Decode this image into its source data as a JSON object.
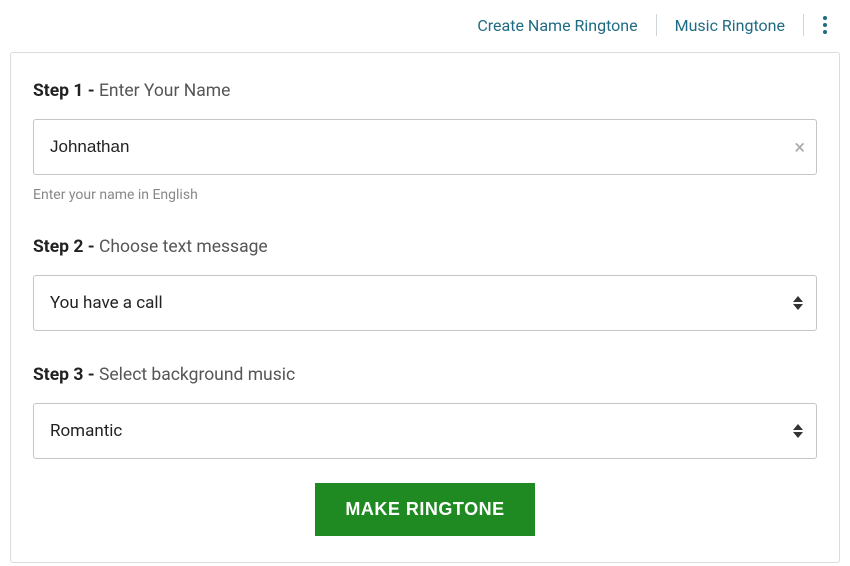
{
  "nav": {
    "link1": "Create Name Ringtone",
    "link2": "Music Ringtone"
  },
  "step1": {
    "prefix": "Step 1 - ",
    "label": "Enter Your Name",
    "value": "Johnathan",
    "hint": "Enter your name in English"
  },
  "step2": {
    "prefix": "Step 2 - ",
    "label": "Choose text message",
    "selected": "You have a call"
  },
  "step3": {
    "prefix": "Step 3 - ",
    "label": "Select background music",
    "selected": "Romantic"
  },
  "submit": {
    "label": "MAKE RINGTONE"
  }
}
